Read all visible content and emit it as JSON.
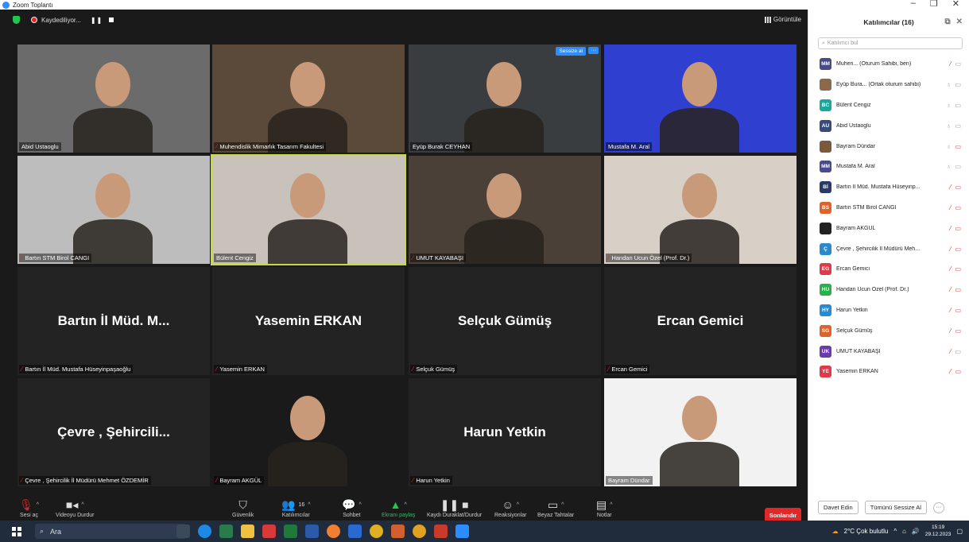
{
  "window": {
    "title": "Zoom Toplantı",
    "controls": [
      "–",
      "❐",
      "✕"
    ]
  },
  "topbar": {
    "recording_label": "Kaydediliyor...",
    "view_label": "Görüntüle"
  },
  "tiles": [
    {
      "name": "Abid Ustaoglu",
      "muted": false,
      "bg": "#6b6b6b"
    },
    {
      "name": "Muhendislik Mimarlık Tasarım Fakultesi",
      "muted": true,
      "bg": "#5b4a3a"
    },
    {
      "name": "Eyüp Burak CEYHAN",
      "muted": false,
      "bg": "#3a3d40",
      "mute_btn": "Sessize al",
      "more_btn": "···"
    },
    {
      "name": "Mustafa M. Aral",
      "muted": false,
      "bg": "#2f3fd0"
    },
    {
      "name": "Bartın STM Birol CANGI",
      "muted": true,
      "bg": "#bdbdbd"
    },
    {
      "name": "Bülent Cengiz",
      "muted": false,
      "bg": "#c9c2ba",
      "active": true
    },
    {
      "name": "UMUT KAYABAŞI",
      "muted": true,
      "bg": "#4a4038"
    },
    {
      "name": "Handan Ucun Özel (Prof. Dr.)",
      "muted": true,
      "bg": "#d8d0c6"
    },
    {
      "name": "Bartın İl Müd. Mustafa Hüseyinpaşaoğlu",
      "muted": true,
      "big": "Bartın İl Müd. M..."
    },
    {
      "name": "Yasemin ERKAN",
      "muted": true,
      "big": "Yasemin ERKAN"
    },
    {
      "name": "Selçuk Gümüş",
      "muted": true,
      "big": "Selçuk Gümüş"
    },
    {
      "name": "Ercan Gemici",
      "muted": true,
      "big": "Ercan Gemici"
    },
    {
      "name": "Çevre , Şehircilik  İl Müdürü Mehmet ÖZDEMİR",
      "muted": true,
      "big": "Çevre , Şehircili..."
    },
    {
      "name": "Bayram AKGÜL",
      "muted": true,
      "bg": "#1a1a1a"
    },
    {
      "name": "Harun Yetkin",
      "muted": true,
      "big": "Harun Yetkin"
    },
    {
      "name": "Bayram Dündar",
      "muted": false,
      "bg": "#f2f2f2"
    }
  ],
  "toolbar": {
    "mute": "Sesi aç",
    "video": "Videoyu Durdur",
    "security": "Güvenlik",
    "participants": "Katılımcılar",
    "participants_count": "16",
    "chat": "Sohbet",
    "share": "Ekranı paylaş",
    "record": "Kaydı Duraklat/Durdur",
    "reactions": "Reaksiyonlar",
    "whiteboard": "Beyaz Tahtalar",
    "notes": "Notlar",
    "end": "Sonlandır"
  },
  "panel": {
    "title": "Katılımcılar (16)",
    "search_placeholder": "Katılımcı bul",
    "participants": [
      {
        "initials": "MM",
        "color": "#4a4a8a",
        "name": "Muhen... (Oturum Sahibi, ben)",
        "mic": "red",
        "cam": "gray"
      },
      {
        "initials": "",
        "color": "#8a6a4a",
        "name": "Eyüp Bura... (Ortak oturum sahibi)",
        "mic": "gray",
        "cam": "gray"
      },
      {
        "initials": "BC",
        "color": "#1aa89a",
        "name": "Bülent Cengiz",
        "mic": "gray",
        "cam": "gray"
      },
      {
        "initials": "AU",
        "color": "#3a4a7a",
        "name": "Abid Ustaoglu",
        "mic": "gray",
        "cam": "gray"
      },
      {
        "initials": "",
        "color": "#7a5a3a",
        "name": "Bayram Dündar",
        "mic": "gray",
        "cam": "red"
      },
      {
        "initials": "MM",
        "color": "#4a4a8a",
        "name": "Mustafa M. Aral",
        "mic": "gray",
        "cam": "gray"
      },
      {
        "initials": "Bİ",
        "color": "#2a3a6a",
        "name": "Bartın İl Müd. Mustafa Hüseyinp...",
        "mic": "red",
        "cam": "red"
      },
      {
        "initials": "BS",
        "color": "#e0622a",
        "name": "Bartın STM Birol CANGI",
        "mic": "red",
        "cam": "red"
      },
      {
        "initials": "",
        "color": "#222222",
        "name": "Bayram AKGÜL",
        "mic": "red",
        "cam": "red"
      },
      {
        "initials": "Ç",
        "color": "#2a8ad0",
        "name": "Çevre , Şehircilik  İl Müdürü Meh...",
        "mic": "red",
        "cam": "red"
      },
      {
        "initials": "EG",
        "color": "#e03a4a",
        "name": "Ercan Gemici",
        "mic": "red",
        "cam": "red"
      },
      {
        "initials": "HU",
        "color": "#2ab04a",
        "name": "Handan Ucun Özel (Prof. Dr.)",
        "mic": "red",
        "cam": "red"
      },
      {
        "initials": "HY",
        "color": "#2a8ad0",
        "name": "Harun Yetkin",
        "mic": "red",
        "cam": "red"
      },
      {
        "initials": "SG",
        "color": "#e0622a",
        "name": "Selçuk Gümüş",
        "mic": "red",
        "cam": "red"
      },
      {
        "initials": "UK",
        "color": "#6a3ab0",
        "name": "UMUT KAYABAŞI",
        "mic": "red",
        "cam": "gray"
      },
      {
        "initials": "YE",
        "color": "#e03a4a",
        "name": "Yasemin ERKAN",
        "mic": "red",
        "cam": "red"
      }
    ],
    "invite": "Davet Edin",
    "mute_all": "Tümünü Sessize Al",
    "more": "···"
  },
  "taskbar": {
    "search": "Ara",
    "weather": "2°C  Çok bulutlu",
    "time": "15:19",
    "date": "29.12.2023"
  }
}
